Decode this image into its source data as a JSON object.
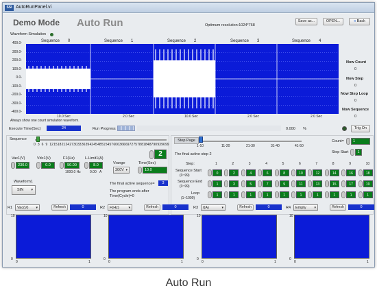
{
  "window": {
    "title": "AutoRunPanel.vi",
    "icon_text": "SSI"
  },
  "header": {
    "demo_mode": "Demo Mode",
    "auto_run": "Auto Run",
    "resolution": "Optimum resolution:1024*768",
    "save_as": "Save as...",
    "open": "OPEN...",
    "back": "Back"
  },
  "waveform": {
    "label": "Waveform Simulation",
    "y_ticks": [
      "400.0-",
      "300.0-",
      "200.0-",
      "100.0-",
      "0.0-",
      "-100.0-",
      "-200.0-",
      "-300.0-",
      "-400.0-"
    ],
    "sequences": [
      {
        "label": "Sequence",
        "num": "0"
      },
      {
        "label": "Sequence",
        "num": "1"
      },
      {
        "label": "Sequence",
        "num": "2"
      },
      {
        "label": "Sequence",
        "num": "3"
      },
      {
        "label": "Sequence",
        "num": "4"
      }
    ],
    "time_labels": [
      "10.0 Sec",
      "2.0 Sec",
      "10.0 Sec",
      "2.0 Sec",
      "2.0 Sec"
    ],
    "note": "Always show one count simulation waveform."
  },
  "status": {
    "now_count_label": "Now Count",
    "now_count": "0",
    "now_step_label": "Now Step",
    "now_step": "0",
    "now_step_loop_label": "Now Step Loop",
    "now_step_loop": "0",
    "now_sequence_label": "Now Sequence",
    "now_sequence": "0"
  },
  "exec": {
    "label": "Execute Time(Sec)",
    "value": "24",
    "progress_label": "Run Progress",
    "percent": "0.000",
    "percent_unit": "%",
    "trig_on": "Trig On"
  },
  "sequence_slider": {
    "label": "Sequence",
    "ticks": [
      "0",
      "3",
      "6",
      "9",
      "12",
      "15",
      "18",
      "21",
      "24",
      "27",
      "30",
      "33",
      "36",
      "39",
      "42",
      "45",
      "48",
      "51",
      "54",
      "57",
      "60",
      "63",
      "66",
      "69",
      "72",
      "75",
      "78",
      "81",
      "84",
      "87",
      "90",
      "93",
      "96",
      "99"
    ],
    "value": "2",
    "slider_fraction": 0.02
  },
  "step_page": {
    "label": "Step Page",
    "ticks": [
      "1-10",
      "11-20",
      "21-30",
      "31-40",
      "41-50"
    ],
    "final_active_step": "The final active step",
    "final_active_step_value": "2",
    "count_label": "Count=",
    "count_value": "1",
    "step_start_label": "Step Start",
    "step_start_value": "1"
  },
  "params": {
    "vac1_label": "Vac1(V)",
    "vac1": "230.0",
    "vdc1_label": "Vdc1(V)",
    "vdc1": "0.0",
    "f1_label": "F1(Hz)",
    "f1": "50.00",
    "f1_sub": "1000.0 Hz",
    "llimit_label": "L.Limit1(A)",
    "llimit": "8.0",
    "llimit_sub1": "0.00",
    "llimit_sub2": "A",
    "waveform_label": "Waveform1",
    "waveform_value": "SIN",
    "vrange_label": "Vrange",
    "vrange_value": "300V",
    "time_label": "Time(Sec)",
    "time_value": "10.0",
    "final_active_sequence_label": "The final active sequence=",
    "final_active_sequence": "3",
    "program_end_note": "The program ends after Time(Cycle)=0"
  },
  "steps": {
    "step_label": "Step:",
    "seq_start_label": "Sequence Start",
    "seq_start_range": "(0~99)",
    "seq_end_label": "Sequence End",
    "seq_end_range": "(0~99)",
    "loop_label": "Loop",
    "loop_range": "(1~1000)",
    "numbers": [
      "1",
      "2",
      "3",
      "4",
      "5",
      "6",
      "7",
      "8",
      "9",
      "10"
    ],
    "seq_start": [
      "0",
      "2",
      "4",
      "6",
      "8",
      "10",
      "12",
      "14",
      "16",
      "18"
    ],
    "seq_end": [
      "1",
      "3",
      "5",
      "7",
      "9",
      "11",
      "13",
      "15",
      "17",
      "19"
    ],
    "loop": [
      "1",
      "1",
      "1",
      "1",
      "1",
      "1",
      "1",
      "1",
      "1",
      "1"
    ]
  },
  "readouts": [
    {
      "id": "R1",
      "select": "Vac(V)",
      "refresh": "Refresh",
      "value": "0",
      "ytop": "10",
      "ybot": "0",
      "x0": "0",
      "x1": "1"
    },
    {
      "id": "R2",
      "select": "F(Hz)",
      "refresh": "Refresh",
      "value": "0",
      "ytop": "10",
      "ybot": "0",
      "x0": "0",
      "x1": "1"
    },
    {
      "id": "R3",
      "select": "I(A)",
      "refresh": "Refresh",
      "value": "0",
      "ytop": "10",
      "ybot": "0",
      "x0": "0",
      "x1": "1"
    },
    {
      "id": "R4",
      "select": "Empty",
      "refresh": "Refresh",
      "value": "0",
      "ytop": "10",
      "ybot": "0",
      "x0": "0",
      "x1": "1"
    }
  ],
  "caption": "Auto Run",
  "colors": {
    "plot_blue": "#0b1bd8",
    "led_green": "#0a7d1c",
    "bar_blue": "#1832cc"
  }
}
